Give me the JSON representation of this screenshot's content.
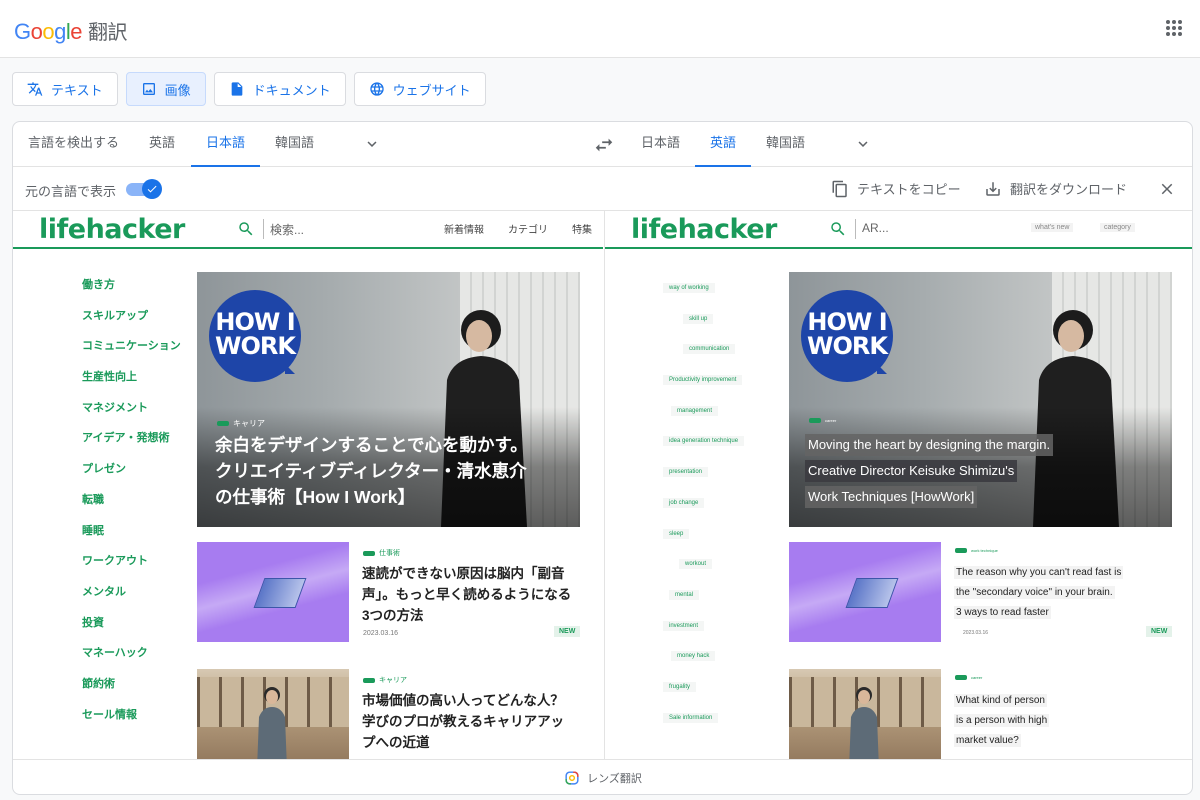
{
  "app": {
    "logo_parts": [
      "G",
      "o",
      "o",
      "g",
      "l",
      "e"
    ],
    "product": "翻訳"
  },
  "modes": [
    {
      "label": "テキスト",
      "icon": "translate-icon",
      "active": false
    },
    {
      "label": "画像",
      "icon": "image-icon",
      "active": true
    },
    {
      "label": "ドキュメント",
      "icon": "document-icon",
      "active": false
    },
    {
      "label": "ウェブサイト",
      "icon": "globe-icon",
      "active": false
    }
  ],
  "source_langs": {
    "detect": "言語を検出する",
    "tabs": [
      "英語",
      "日本語",
      "韓国語"
    ],
    "selected": "日本語"
  },
  "target_langs": {
    "tabs": [
      "日本語",
      "英語",
      "韓国語"
    ],
    "selected": "英語"
  },
  "toolbar": {
    "show_original": "元の言語で表示",
    "show_original_on": true,
    "copy": "テキストをコピー",
    "download": "翻訳をダウンロード"
  },
  "original": {
    "logo": "lifehacker",
    "search_placeholder": "検索...",
    "nav": [
      "新着情報",
      "カテゴリ",
      "特集"
    ],
    "sidebar": [
      "働き方",
      "スキルアップ",
      "コミュニケーション",
      "生産性向上",
      "マネジメント",
      "アイデア・発想術",
      "プレゼン",
      "転職",
      "睡眠",
      "ワークアウト",
      "メンタル",
      "投資",
      "マネーハック",
      "節約術",
      "セール情報"
    ],
    "hero": {
      "badge_line1": "HOW I",
      "badge_line2": "WORK",
      "tag": "キャリア",
      "title_lines": [
        "余白をデザインすることで心を動かす。",
        "クリエイティブディレクター・清水恵介",
        "の仕事術【How I Work】"
      ]
    },
    "articles": [
      {
        "tag": "仕事術",
        "title": "速読ができない原因は脳内「副音声」。もっと早く読めるようになる3つの方法",
        "date": "2023.03.16",
        "badge": "NEW"
      },
      {
        "tag": "キャリア",
        "title": "市場価値の高い人ってどんな人？ 学びのプロが教えるキャリアアップへの近道"
      }
    ]
  },
  "translated": {
    "logo": "lifehacker",
    "search_placeholder": "AR...",
    "nav": [
      "what's new",
      "category"
    ],
    "sidebar": [
      "way of working",
      "skill up",
      "communication",
      "Productivity improvement",
      "management",
      "idea generation technique",
      "presentation",
      "job change",
      "sleep",
      "workout",
      "mental",
      "investment",
      "money hack",
      "frugality",
      "Sale information"
    ],
    "hero": {
      "badge_line1": "HOW I",
      "badge_line2": "WORK",
      "tag": "career",
      "title_lines": [
        "Moving the heart by designing the margin.",
        "Creative Director Keisuke Shimizu's",
        "Work Techniques [HowWork]"
      ]
    },
    "articles": [
      {
        "tag": "work technique",
        "title_lines": [
          "The reason why you can't read fast is",
          "the \"secondary voice\" in your brain.",
          "3 ways to read faster"
        ],
        "date": "2023.03.16",
        "badge": "NEW"
      },
      {
        "tag": "career",
        "title_lines": [
          "What kind of person",
          "is a person with high",
          "market value?"
        ]
      }
    ]
  },
  "footer": {
    "lens_label": "レンズ翻訳"
  }
}
